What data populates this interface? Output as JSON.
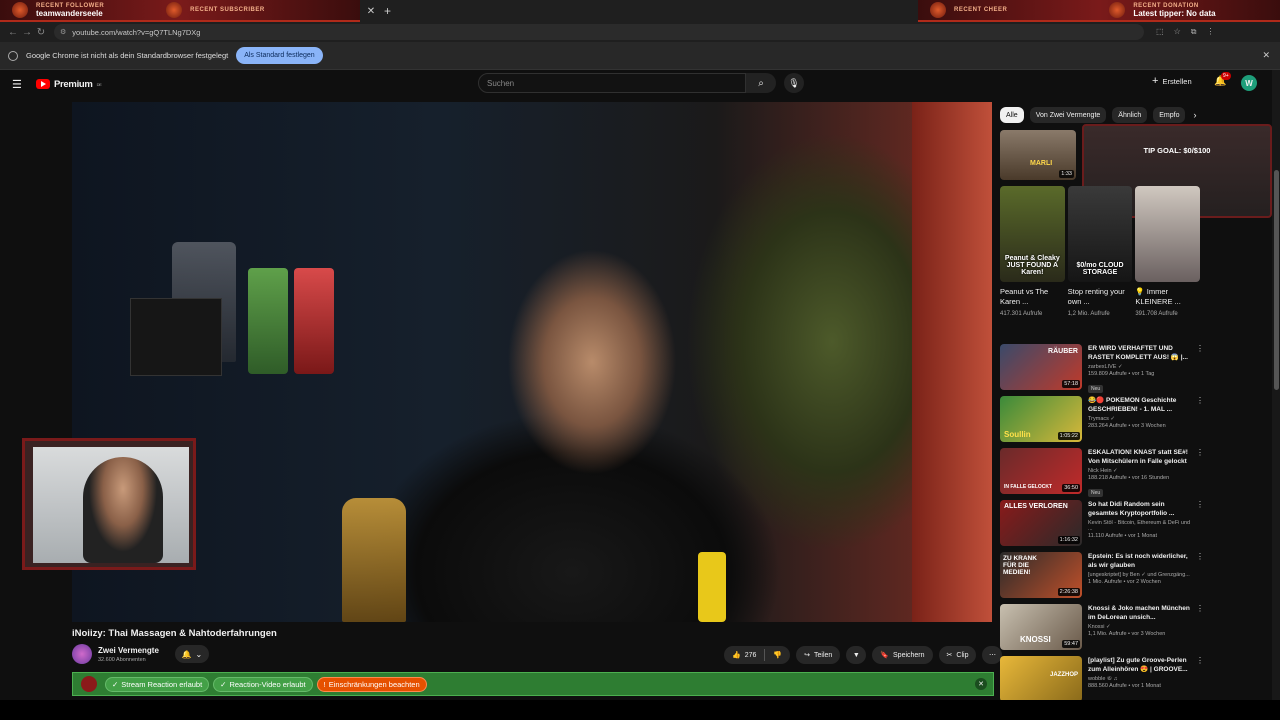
{
  "overlay": {
    "recent_follower_title": "RECENT FOLLOWER",
    "recent_follower_value": "teamwanderseele",
    "recent_subscriber_title": "RECENT SUBSCRIBER",
    "recent_cheer_title": "RECENT CHEER",
    "recent_donation_title": "RECENT DONATION",
    "recent_donation_value": "Latest tipper: No data",
    "tip_goal": "TIP GOAL: $0/$100"
  },
  "browser": {
    "url": "youtube.com/watch?v=gQ7TLNg7DXg",
    "infobar_text": "Google Chrome ist nicht als dein Standardbrowser festgelegt",
    "infobar_button": "Als Standard festlegen"
  },
  "header": {
    "logo_text": "Premium",
    "logo_region": "DE",
    "search_placeholder": "Suchen",
    "create_label": "Erstellen",
    "notification_count": "9+",
    "avatar_letter": "W"
  },
  "video": {
    "title": "iNoiizy: Thai Massagen & Nahtoderfahrungen",
    "channel_name": "Zwei Vermengte",
    "channel_subs": "32.600 Abonnenten",
    "like_count": "276",
    "share_label": "Teilen",
    "save_label": "Speichern",
    "clip_label": "Clip"
  },
  "reaction_bar": {
    "tag1": "Stream Reaction erlaubt",
    "tag2": "Reaction-Video erlaubt",
    "tag3": "Einschränkungen beachten"
  },
  "sidebar": {
    "chips": [
      "Alle",
      "Von Zwei Vermengte",
      "Ähnlich",
      "Empfo"
    ],
    "shorts_small_duration": "1:33",
    "shorts_small_caption": "MARLI",
    "shorts": [
      {
        "caption": "Peanut & Cleaky JUST FOUND A Karen!",
        "title": "Peanut vs The Karen ...",
        "views": "417.301 Aufrufe"
      },
      {
        "caption": "$0/mo CLOUD STORAGE",
        "title": "Stop renting your own ...",
        "views": "1,2 Mio. Aufrufe"
      },
      {
        "caption": "",
        "title": "💡 Immer KLEINERE ...",
        "views": "391.708 Aufrufe"
      }
    ],
    "recs": [
      {
        "title": "ER WIRD VERHAFTET UND RASTET KOMPLETT AUS! 😱 |...",
        "channel": "zarbexLIVE ✓",
        "meta": "159.809 Aufrufe • vor 1 Tag",
        "duration": "57:18",
        "badge": "Neu",
        "thumb_text": "RÄUBER"
      },
      {
        "title": "😂🔴 POKEMON Geschichte GESCHRIEBEN! - 1. MAL ...",
        "channel": "Trymacs ✓",
        "meta": "283.264 Aufrufe • vor 3 Wochen",
        "duration": "1:05:22",
        "badge": "",
        "thumb_text": "Soullin"
      },
      {
        "title": "ESKALATION! KNAST statt SE#! Von Mitschülern in Falle gelockt",
        "channel": "Nick Hein ✓",
        "meta": "188.218 Aufrufe • vor 16 Stunden",
        "duration": "36:50",
        "badge": "Neu",
        "thumb_text": "IN FALLE GELOCKT"
      },
      {
        "title": "So hat Didi Random sein gesamtes Kryptoportfolio ...",
        "channel": "Kevin Stöl - Bitcoin, Ethereum & DeFi und ...",
        "meta": "11.110 Aufrufe • vor 1 Monat",
        "duration": "1:16:32",
        "badge": "",
        "thumb_text": "ALLES VERLOREN"
      },
      {
        "title": "Epstein: Es ist noch widerlicher, als wir glauben",
        "channel": "[ungeskriptet] by Ben ✓ und Grenzgäng...",
        "meta": "1 Mio. Aufrufe • vor 2 Wochen",
        "duration": "2:26:38",
        "badge": "",
        "thumb_text": "ZU KRANK FÜR DIE MEDIEN!"
      },
      {
        "title": "Knossi & Joko machen München im DeLorean unsich...",
        "channel": "Knossi ✓",
        "meta": "1,1 Mio. Aufrufe • vor 3 Wochen",
        "duration": "59:47",
        "badge": "",
        "thumb_text": "KNOSSI"
      },
      {
        "title": "[playlist] Zu gute Groove-Perlen zum Alleinhören 😍 | GROOVE...",
        "channel": "wobble ⑥ ♫",
        "meta": "888.560 Aufrufe • vor 1 Monat",
        "duration": "",
        "badge": "",
        "thumb_text": "JAZZHOP"
      }
    ]
  },
  "colors": {
    "brand_red": "#ff0000",
    "reaction_green": "#2e7d32",
    "warning_orange": "#e65100"
  }
}
